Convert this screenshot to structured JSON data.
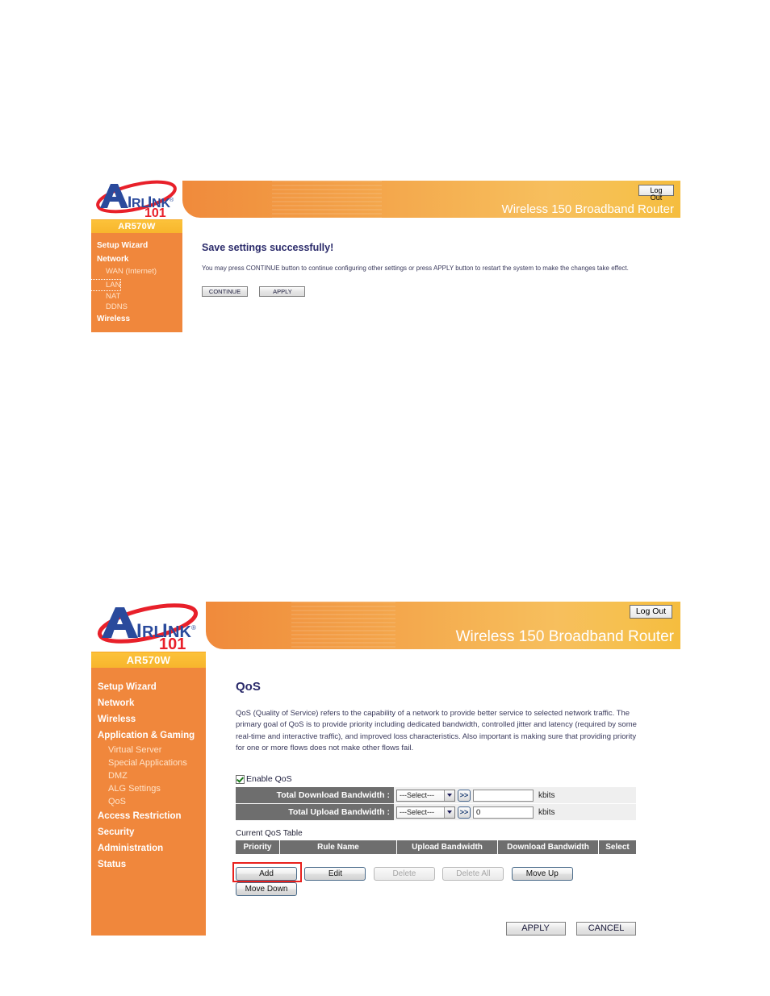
{
  "brand": {
    "logo_text_a": "A",
    "logo_text_main": "IRLINK",
    "logo_registered": "®",
    "logo_number": "101",
    "model": "AR570W",
    "accent_orange": "#f0873c",
    "accent_yellow": "#f7b52c",
    "logo_blue": "#2a4a9c",
    "logo_red": "#e8202a",
    "heading_navy": "#2a2a6a",
    "table_gray": "#6e6e6e",
    "highlight_red": "#e8201c"
  },
  "panel1": {
    "header": {
      "logout_label": "Log Out",
      "title": "Wireless 150 Broadband Router"
    },
    "sidebar": {
      "model": "AR570W",
      "items": [
        {
          "label": "Setup Wizard",
          "level": "top",
          "focused": false
        },
        {
          "label": "Network",
          "level": "top",
          "focused": false
        },
        {
          "label": "WAN (Internet)",
          "level": "sub",
          "focused": false
        },
        {
          "label": "LAN",
          "level": "sub",
          "focused": true
        },
        {
          "label": "NAT",
          "level": "sub",
          "focused": false
        },
        {
          "label": "DDNS",
          "level": "sub",
          "focused": false
        },
        {
          "label": "Wireless",
          "level": "top",
          "focused": false
        }
      ]
    },
    "content": {
      "title": "Save settings successfully!",
      "description": "You may press CONTINUE button to continue configuring other settings or press APPLY button to restart the system to make the changes take effect.",
      "buttons": [
        {
          "label": "CONTINUE",
          "disabled": false
        },
        {
          "label": "APPLY",
          "disabled": false
        }
      ]
    }
  },
  "panel2": {
    "header": {
      "logout_label": "Log Out",
      "title": "Wireless 150 Broadband Router"
    },
    "sidebar": {
      "model": "AR570W",
      "items": [
        {
          "label": "Setup Wizard",
          "level": "top"
        },
        {
          "label": "Network",
          "level": "top"
        },
        {
          "label": "Wireless",
          "level": "top"
        },
        {
          "label": "Application & Gaming",
          "level": "top"
        },
        {
          "label": "Virtual Server",
          "level": "sub"
        },
        {
          "label": "Special Applications",
          "level": "sub"
        },
        {
          "label": "DMZ",
          "level": "sub"
        },
        {
          "label": "ALG Settings",
          "level": "sub"
        },
        {
          "label": "QoS",
          "level": "sub"
        },
        {
          "label": "Access Restriction",
          "level": "top"
        },
        {
          "label": "Security",
          "level": "top"
        },
        {
          "label": "Administration",
          "level": "top"
        },
        {
          "label": "Status",
          "level": "top"
        }
      ]
    },
    "content": {
      "title": "QoS",
      "description": "QoS (Quality of Service) refers to the capability of a network to provide better service to selected network traffic. The primary goal of QoS is to provide priority including dedicated bandwidth, controlled jitter and latency (required by some real-time and interactive traffic), and improved loss characteristics. Also important is making sure that providing priority for one or more flows does not make other flows fail.",
      "enable_qos_label": "Enable QoS",
      "enable_qos_checked": true,
      "form_rows": [
        {
          "label": "Total Download Bandwidth :",
          "select_value": "---Select---",
          "go_label": ">>",
          "value": "",
          "unit": "kbits"
        },
        {
          "label": "Total Upload Bandwidth :",
          "select_value": "---Select---",
          "go_label": ">>",
          "value": "0",
          "unit": "kbits"
        }
      ],
      "table_caption": "Current QoS Table",
      "table_headers": [
        "Priority",
        "Rule Name",
        "Upload Bandwidth",
        "Download Bandwidth",
        "Select"
      ],
      "table_rows": [],
      "action_buttons": [
        {
          "label": "Add",
          "disabled": false,
          "highlighted": true
        },
        {
          "label": "Edit",
          "disabled": false,
          "highlighted": false
        },
        {
          "label": "Delete",
          "disabled": true,
          "highlighted": false
        },
        {
          "label": "Delete All",
          "disabled": true,
          "highlighted": false
        },
        {
          "label": "Move Up",
          "disabled": false,
          "highlighted": false
        },
        {
          "label": "Move Down",
          "disabled": false,
          "highlighted": false
        }
      ],
      "footer_buttons": [
        {
          "label": "APPLY"
        },
        {
          "label": "CANCEL"
        }
      ]
    }
  }
}
